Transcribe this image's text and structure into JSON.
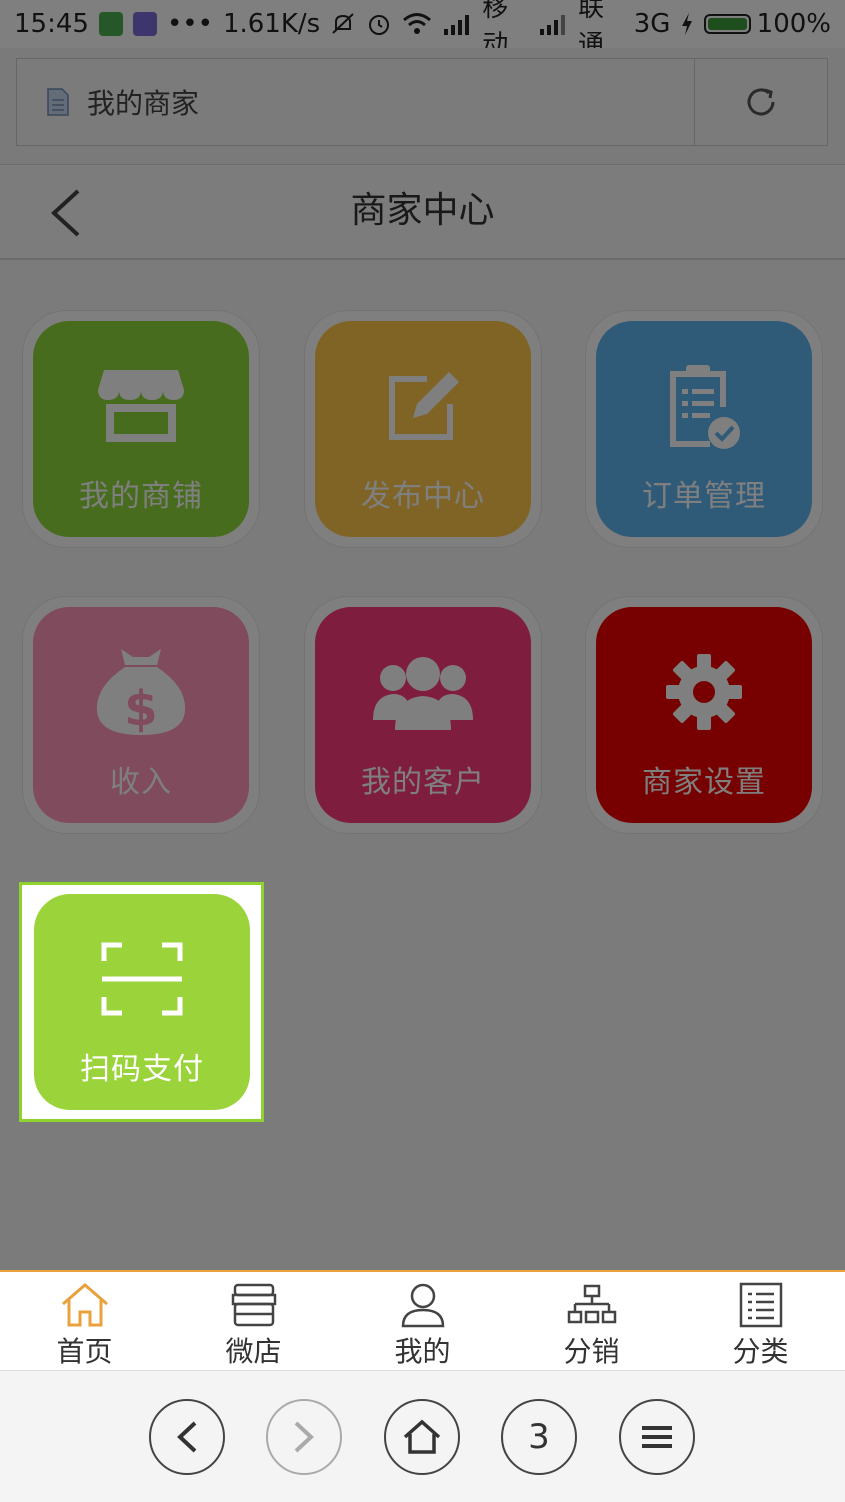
{
  "status_bar": {
    "time": "15:45",
    "dots": "•••",
    "speed": "1.61K/s",
    "carrier1": "移动",
    "carrier2": "联通",
    "network": "3G",
    "battery": "100%"
  },
  "url_bar": {
    "title": "我的商家"
  },
  "header": {
    "title": "商家中心"
  },
  "tiles": [
    {
      "label": "我的商铺",
      "color": "#8fd83a",
      "icon": "store-icon"
    },
    {
      "label": "发布中心",
      "color": "#ffc84a",
      "icon": "edit-icon"
    },
    {
      "label": "订单管理",
      "color": "#5fb6f2",
      "icon": "clipboard-icon"
    },
    {
      "label": "收入",
      "color": "#ff96ba",
      "icon": "money-bag-icon"
    },
    {
      "label": "我的客户",
      "color": "#ff3a7c",
      "icon": "users-icon"
    },
    {
      "label": "商家设置",
      "color": "#ee0000",
      "icon": "gear-icon"
    },
    {
      "label": "扫码支付",
      "color": "#9bd43a",
      "icon": "scan-icon"
    }
  ],
  "tabbar": {
    "items": [
      {
        "label": "首页",
        "icon": "home-icon",
        "active": true
      },
      {
        "label": "微店",
        "icon": "shop-icon"
      },
      {
        "label": "我的",
        "icon": "user-icon"
      },
      {
        "label": "分销",
        "icon": "org-chart-icon"
      },
      {
        "label": "分类",
        "icon": "list-icon"
      }
    ],
    "accent": "#e8a13c"
  },
  "browser_nav": {
    "tab_count": "3"
  },
  "overlay_color": "rgba(0,0,0,0.5)",
  "highlight_color": "#8fd12d"
}
